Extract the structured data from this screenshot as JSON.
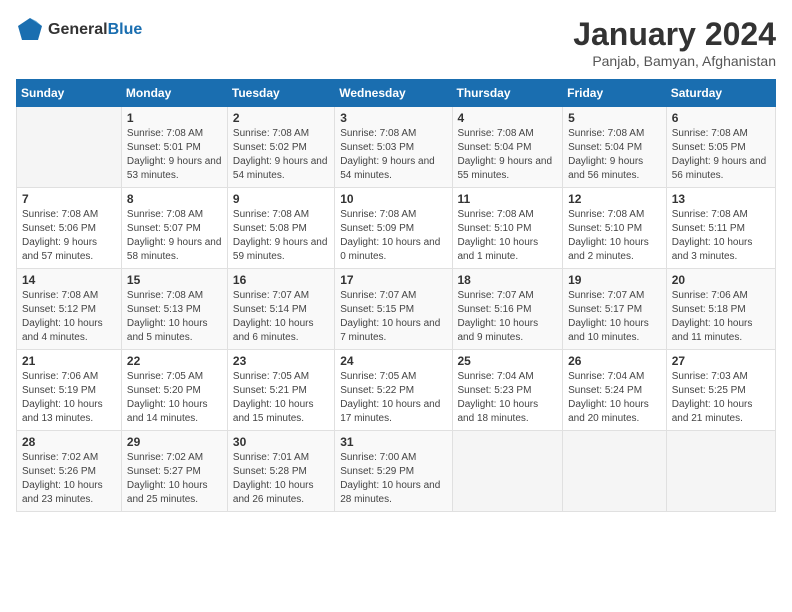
{
  "logo": {
    "general": "General",
    "blue": "Blue"
  },
  "title": "January 2024",
  "subtitle": "Panjab, Bamyan, Afghanistan",
  "days_header": [
    "Sunday",
    "Monday",
    "Tuesday",
    "Wednesday",
    "Thursday",
    "Friday",
    "Saturday"
  ],
  "weeks": [
    [
      {
        "day": "",
        "sunrise": "",
        "sunset": "",
        "daylight": ""
      },
      {
        "day": "1",
        "sunrise": "Sunrise: 7:08 AM",
        "sunset": "Sunset: 5:01 PM",
        "daylight": "Daylight: 9 hours and 53 minutes."
      },
      {
        "day": "2",
        "sunrise": "Sunrise: 7:08 AM",
        "sunset": "Sunset: 5:02 PM",
        "daylight": "Daylight: 9 hours and 54 minutes."
      },
      {
        "day": "3",
        "sunrise": "Sunrise: 7:08 AM",
        "sunset": "Sunset: 5:03 PM",
        "daylight": "Daylight: 9 hours and 54 minutes."
      },
      {
        "day": "4",
        "sunrise": "Sunrise: 7:08 AM",
        "sunset": "Sunset: 5:04 PM",
        "daylight": "Daylight: 9 hours and 55 minutes."
      },
      {
        "day": "5",
        "sunrise": "Sunrise: 7:08 AM",
        "sunset": "Sunset: 5:04 PM",
        "daylight": "Daylight: 9 hours and 56 minutes."
      },
      {
        "day": "6",
        "sunrise": "Sunrise: 7:08 AM",
        "sunset": "Sunset: 5:05 PM",
        "daylight": "Daylight: 9 hours and 56 minutes."
      }
    ],
    [
      {
        "day": "7",
        "sunrise": "Sunrise: 7:08 AM",
        "sunset": "Sunset: 5:06 PM",
        "daylight": "Daylight: 9 hours and 57 minutes."
      },
      {
        "day": "8",
        "sunrise": "Sunrise: 7:08 AM",
        "sunset": "Sunset: 5:07 PM",
        "daylight": "Daylight: 9 hours and 58 minutes."
      },
      {
        "day": "9",
        "sunrise": "Sunrise: 7:08 AM",
        "sunset": "Sunset: 5:08 PM",
        "daylight": "Daylight: 9 hours and 59 minutes."
      },
      {
        "day": "10",
        "sunrise": "Sunrise: 7:08 AM",
        "sunset": "Sunset: 5:09 PM",
        "daylight": "Daylight: 10 hours and 0 minutes."
      },
      {
        "day": "11",
        "sunrise": "Sunrise: 7:08 AM",
        "sunset": "Sunset: 5:10 PM",
        "daylight": "Daylight: 10 hours and 1 minute."
      },
      {
        "day": "12",
        "sunrise": "Sunrise: 7:08 AM",
        "sunset": "Sunset: 5:10 PM",
        "daylight": "Daylight: 10 hours and 2 minutes."
      },
      {
        "day": "13",
        "sunrise": "Sunrise: 7:08 AM",
        "sunset": "Sunset: 5:11 PM",
        "daylight": "Daylight: 10 hours and 3 minutes."
      }
    ],
    [
      {
        "day": "14",
        "sunrise": "Sunrise: 7:08 AM",
        "sunset": "Sunset: 5:12 PM",
        "daylight": "Daylight: 10 hours and 4 minutes."
      },
      {
        "day": "15",
        "sunrise": "Sunrise: 7:08 AM",
        "sunset": "Sunset: 5:13 PM",
        "daylight": "Daylight: 10 hours and 5 minutes."
      },
      {
        "day": "16",
        "sunrise": "Sunrise: 7:07 AM",
        "sunset": "Sunset: 5:14 PM",
        "daylight": "Daylight: 10 hours and 6 minutes."
      },
      {
        "day": "17",
        "sunrise": "Sunrise: 7:07 AM",
        "sunset": "Sunset: 5:15 PM",
        "daylight": "Daylight: 10 hours and 7 minutes."
      },
      {
        "day": "18",
        "sunrise": "Sunrise: 7:07 AM",
        "sunset": "Sunset: 5:16 PM",
        "daylight": "Daylight: 10 hours and 9 minutes."
      },
      {
        "day": "19",
        "sunrise": "Sunrise: 7:07 AM",
        "sunset": "Sunset: 5:17 PM",
        "daylight": "Daylight: 10 hours and 10 minutes."
      },
      {
        "day": "20",
        "sunrise": "Sunrise: 7:06 AM",
        "sunset": "Sunset: 5:18 PM",
        "daylight": "Daylight: 10 hours and 11 minutes."
      }
    ],
    [
      {
        "day": "21",
        "sunrise": "Sunrise: 7:06 AM",
        "sunset": "Sunset: 5:19 PM",
        "daylight": "Daylight: 10 hours and 13 minutes."
      },
      {
        "day": "22",
        "sunrise": "Sunrise: 7:05 AM",
        "sunset": "Sunset: 5:20 PM",
        "daylight": "Daylight: 10 hours and 14 minutes."
      },
      {
        "day": "23",
        "sunrise": "Sunrise: 7:05 AM",
        "sunset": "Sunset: 5:21 PM",
        "daylight": "Daylight: 10 hours and 15 minutes."
      },
      {
        "day": "24",
        "sunrise": "Sunrise: 7:05 AM",
        "sunset": "Sunset: 5:22 PM",
        "daylight": "Daylight: 10 hours and 17 minutes."
      },
      {
        "day": "25",
        "sunrise": "Sunrise: 7:04 AM",
        "sunset": "Sunset: 5:23 PM",
        "daylight": "Daylight: 10 hours and 18 minutes."
      },
      {
        "day": "26",
        "sunrise": "Sunrise: 7:04 AM",
        "sunset": "Sunset: 5:24 PM",
        "daylight": "Daylight: 10 hours and 20 minutes."
      },
      {
        "day": "27",
        "sunrise": "Sunrise: 7:03 AM",
        "sunset": "Sunset: 5:25 PM",
        "daylight": "Daylight: 10 hours and 21 minutes."
      }
    ],
    [
      {
        "day": "28",
        "sunrise": "Sunrise: 7:02 AM",
        "sunset": "Sunset: 5:26 PM",
        "daylight": "Daylight: 10 hours and 23 minutes."
      },
      {
        "day": "29",
        "sunrise": "Sunrise: 7:02 AM",
        "sunset": "Sunset: 5:27 PM",
        "daylight": "Daylight: 10 hours and 25 minutes."
      },
      {
        "day": "30",
        "sunrise": "Sunrise: 7:01 AM",
        "sunset": "Sunset: 5:28 PM",
        "daylight": "Daylight: 10 hours and 26 minutes."
      },
      {
        "day": "31",
        "sunrise": "Sunrise: 7:00 AM",
        "sunset": "Sunset: 5:29 PM",
        "daylight": "Daylight: 10 hours and 28 minutes."
      },
      {
        "day": "",
        "sunrise": "",
        "sunset": "",
        "daylight": ""
      },
      {
        "day": "",
        "sunrise": "",
        "sunset": "",
        "daylight": ""
      },
      {
        "day": "",
        "sunrise": "",
        "sunset": "",
        "daylight": ""
      }
    ]
  ]
}
